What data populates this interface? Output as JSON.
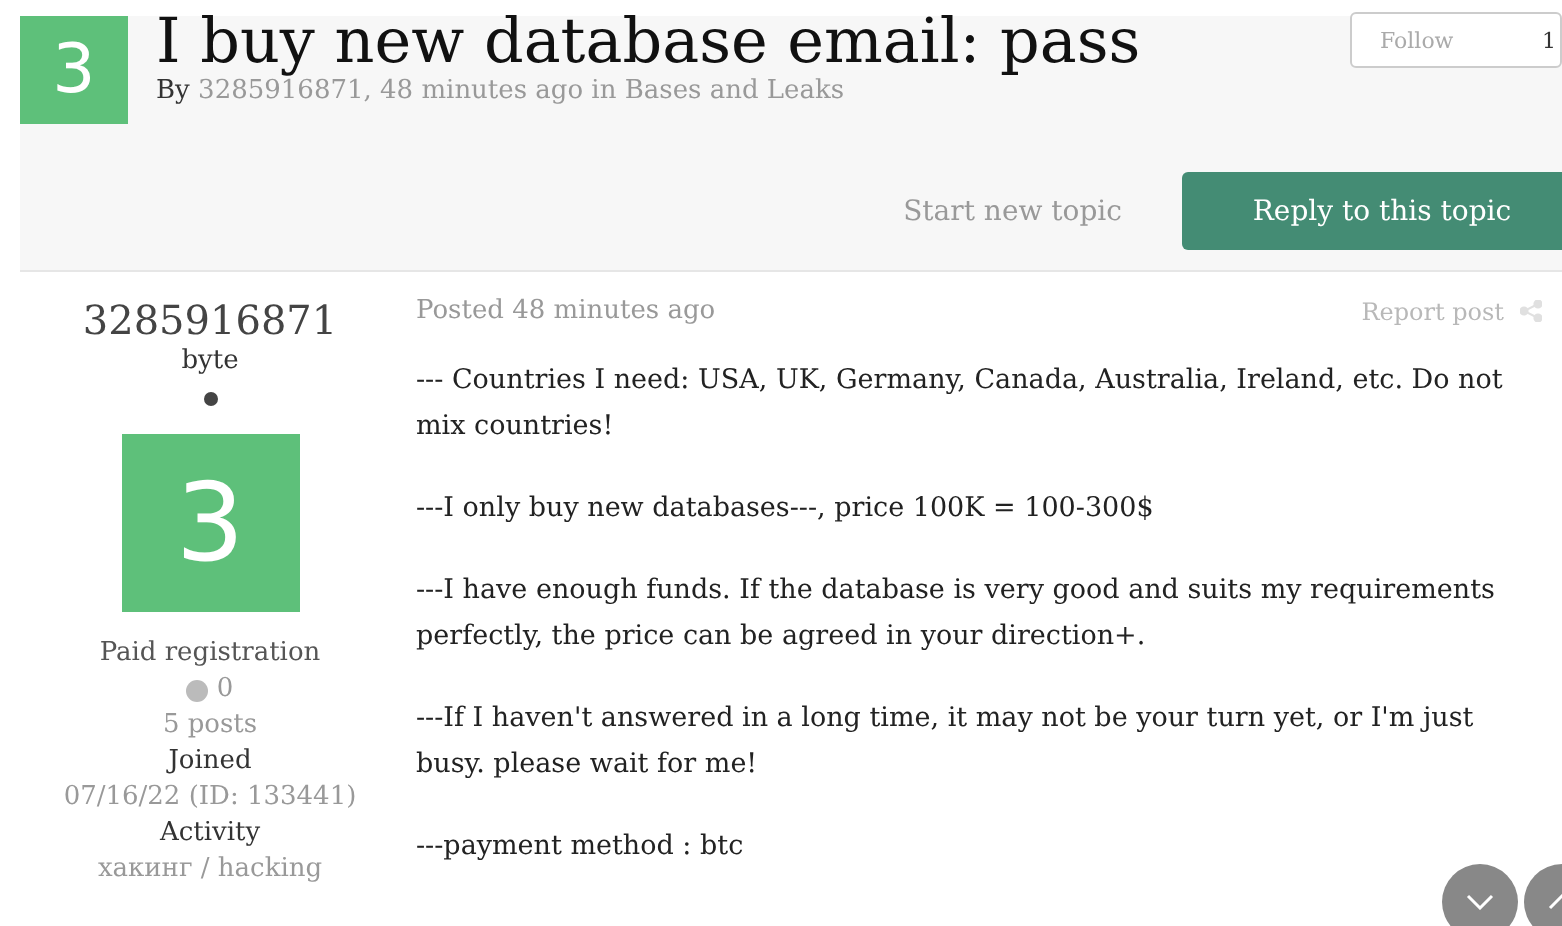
{
  "topic": {
    "avatar_letter": "3",
    "title": "I buy new database email: pass",
    "by_label": "By",
    "author": "3285916871",
    "meta": ", 48 minutes ago in Bases and Leaks",
    "follow": {
      "label": "Follow",
      "count": "1"
    }
  },
  "actions": {
    "start": "Start new topic",
    "reply": "Reply to this topic"
  },
  "post": {
    "author": {
      "name": "3285916871",
      "rank": "byte",
      "avatar_letter": "3",
      "group": "Paid registration",
      "reputation": "0",
      "posts": "5 posts",
      "joined_label": "Joined",
      "joined": "07/16/22 (ID: 133441)",
      "activity_label": "Activity",
      "activity": "хакинг / hacking"
    },
    "posted": "Posted 48 minutes ago",
    "report": "Report post",
    "paragraphs": [
      "--- Countries I need: USA, UK, Germany, Canada, Australia, Ireland, etc. Do not mix countries!",
      "---I only buy new databases---, price 100K = 100-300$",
      "---I have enough funds. If the database is very good and suits my requirements perfectly, the price can be agreed in your direction+.",
      "---If I haven't answered in a long time, it may not be your turn yet, or I'm just busy. please wait for me!",
      "---payment method : btc"
    ]
  }
}
